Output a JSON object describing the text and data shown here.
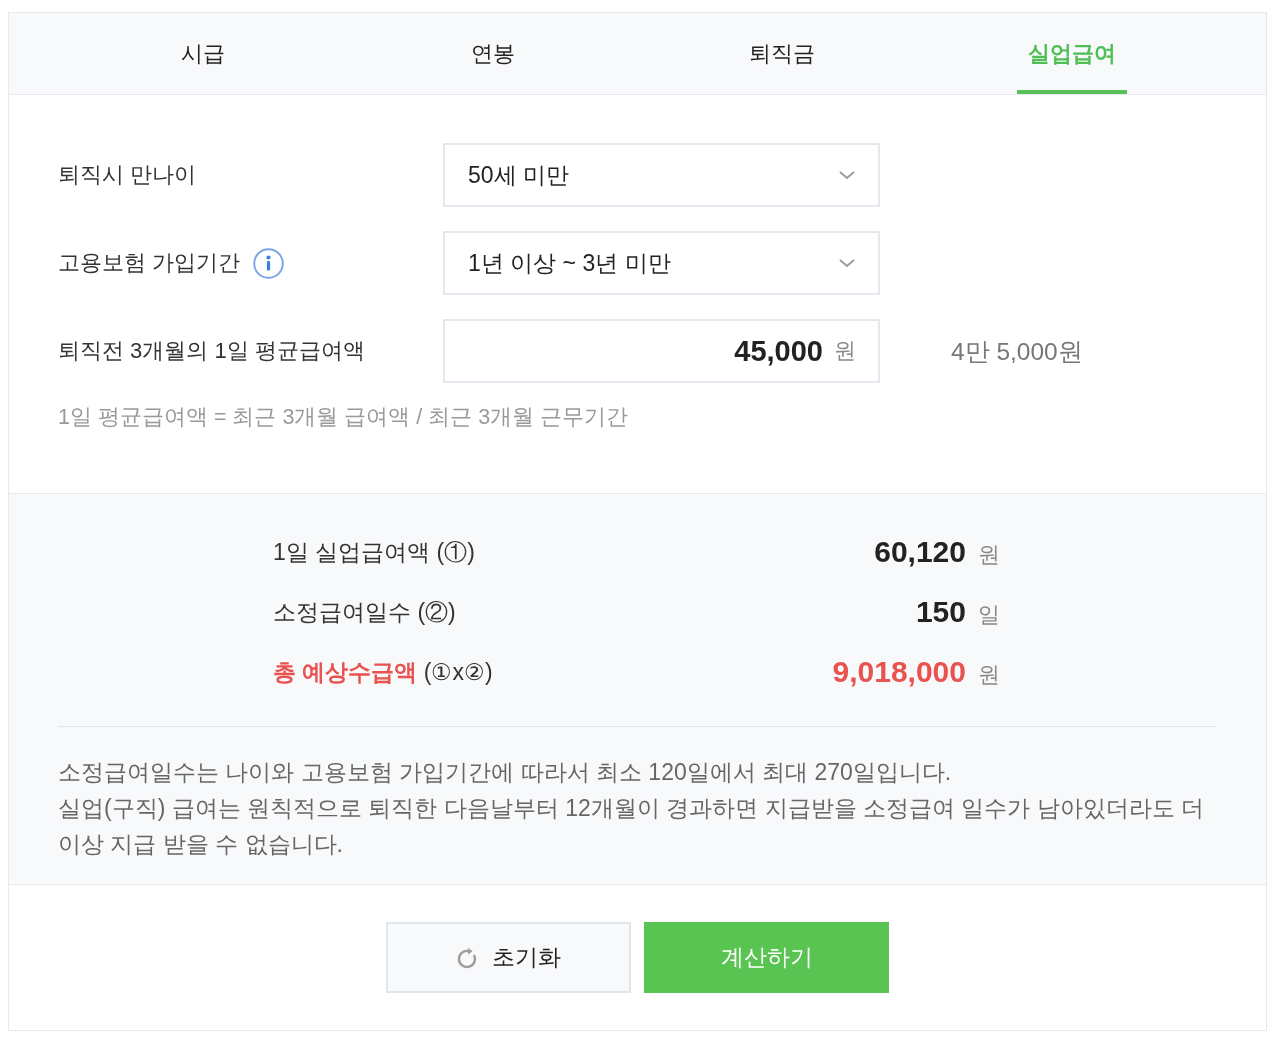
{
  "tabs": [
    {
      "label": "시급",
      "selected": false
    },
    {
      "label": "연봉",
      "selected": false
    },
    {
      "label": "퇴직금",
      "selected": false
    },
    {
      "label": "실업급여",
      "selected": true
    }
  ],
  "form": {
    "fields": [
      {
        "kind": "select",
        "label": "퇴직시 만나이",
        "info": false,
        "value": "50세 미만"
      },
      {
        "kind": "select",
        "label": "고용보험 가입기간",
        "info": true,
        "value": "1년 이상 ~ 3년 미만"
      },
      {
        "kind": "amount",
        "label": "퇴직전 3개월의 1일 평균급여액",
        "info": false,
        "value": "45,000",
        "unit": "원",
        "reading": "4만 5,000원"
      }
    ],
    "hint": "1일 평균급여액 = 최근 3개월 급여액 / 최근 3개월 근무기간"
  },
  "results": {
    "rows": [
      {
        "kind": "normal",
        "label": "1일 실업급여액 (①)",
        "value": "60,120",
        "unit": "원"
      },
      {
        "kind": "normal",
        "label": "소정급여일수 (②)",
        "value": "150",
        "unit": "일"
      },
      {
        "kind": "total",
        "label": "**총 예상수급액** (①x②)",
        "value": "9,018,000",
        "unit": "원"
      }
    ],
    "notes": [
      "소정급여일수는 나이와 고용보험 가입기간에 따라서 최소 120일에서 최대 270일입니다.",
      "실업(구직) 급여는 원칙적으로 퇴직한 다음날부터 12개월이 경과하면 지급받을 소정급여 일수가 남아있더라도 더 이상 지급 받을 수 없습니다."
    ]
  },
  "buttons": [
    {
      "kind": "reset",
      "label": "초기화"
    },
    {
      "kind": "primary",
      "label": "계산하기"
    }
  ]
}
